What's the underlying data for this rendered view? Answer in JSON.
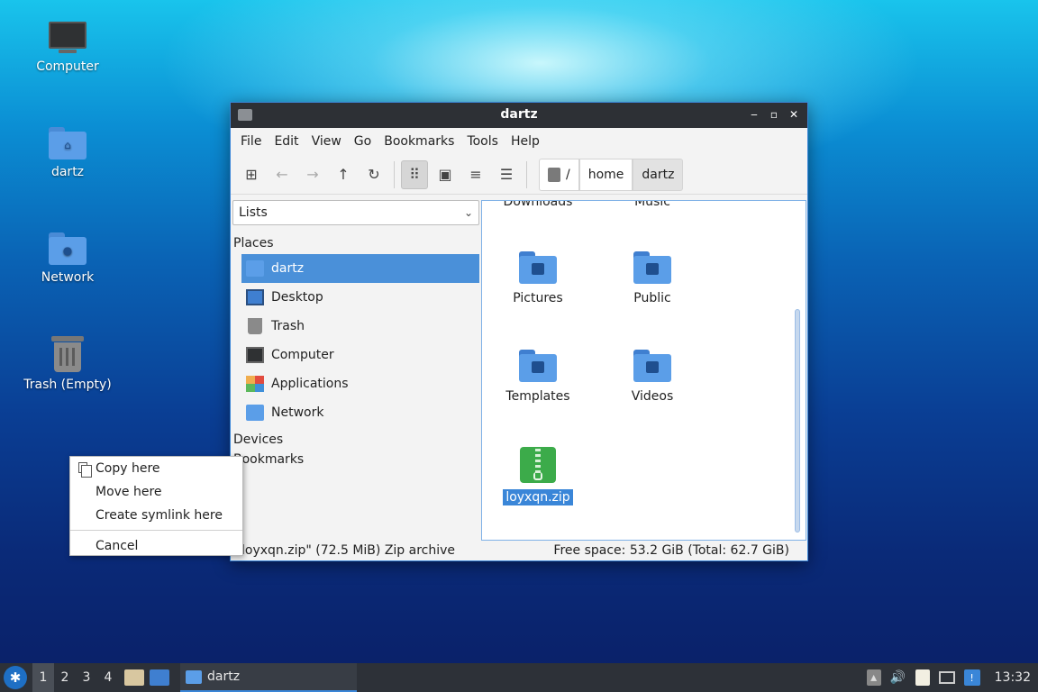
{
  "desktop": {
    "icons": [
      {
        "label": "Computer",
        "icon": "computer-icon"
      },
      {
        "label": "dartz",
        "icon": "home-folder-icon"
      },
      {
        "label": "Network",
        "icon": "network-folder-icon"
      },
      {
        "label": "Trash (Empty)",
        "icon": "trash-icon"
      }
    ]
  },
  "window": {
    "title": "dartz",
    "controls": {
      "minimize": "‒",
      "maximize": "▫",
      "close": "✕"
    },
    "menu": [
      "File",
      "Edit",
      "View",
      "Go",
      "Bookmarks",
      "Tools",
      "Help"
    ],
    "toolbar": {
      "icons": [
        "new-tab-icon",
        "back-arrow-icon",
        "forward-arrow-icon",
        "up-arrow-icon",
        "reload-icon",
        "icon-view-icon",
        "thumbnail-view-icon",
        "compact-view-icon",
        "detail-list-view-icon"
      ],
      "path": {
        "root": "/",
        "segments": [
          "home",
          "dartz"
        ]
      }
    },
    "side_panel": {
      "mode": "Lists",
      "places_header": "Places",
      "places": [
        "dartz",
        "Desktop",
        "Trash",
        "Computer",
        "Applications",
        "Network"
      ],
      "selected": "dartz",
      "devices_header": "Devices",
      "bookmarks_header": "Bookmarks"
    },
    "files": {
      "partial_top": [
        "Downloads",
        "Music"
      ],
      "items": [
        {
          "name": "Pictures",
          "icon": "pictures-folder-icon"
        },
        {
          "name": "Public",
          "icon": "public-folder-icon"
        },
        {
          "name": "Templates",
          "icon": "templates-folder-icon"
        },
        {
          "name": "Videos",
          "icon": "videos-folder-icon"
        },
        {
          "name": "loyxqn.zip",
          "icon": "zip-archive-icon",
          "selected": true
        }
      ]
    },
    "statusbar": {
      "left": "loyxqn.zip\" (72.5 MiB) Zip archive",
      "right": "Free space: 53.2 GiB (Total: 62.7 GiB)"
    }
  },
  "context_menu": {
    "items": [
      "Copy here",
      "Move here",
      "Create symlink here",
      "Cancel"
    ]
  },
  "taskbar": {
    "workspaces": [
      "1",
      "2",
      "3",
      "4"
    ],
    "current_workspace": "1",
    "task_label": "dartz",
    "clock": "13:32"
  },
  "colors": {
    "accent": "#3a86d8",
    "taskbar": "#2d3138",
    "titlebar": "#2d3035",
    "folder": "#5b9ee8",
    "zip": "#3cab4a"
  }
}
